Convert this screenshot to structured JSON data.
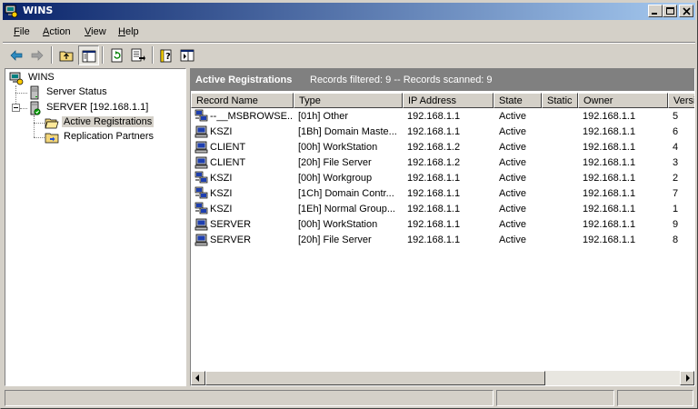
{
  "window": {
    "title": "WINS"
  },
  "menu": {
    "file": "File",
    "action": "Action",
    "view": "View",
    "help": "Help"
  },
  "tree": {
    "root": "WINS",
    "server_status": "Server Status",
    "server": "SERVER [192.168.1.1]",
    "active_registrations": "Active Registrations",
    "replication_partners": "Replication Partners"
  },
  "results": {
    "title": "Active Registrations",
    "info": "Records filtered: 9 -- Records scanned: 9",
    "columns": [
      "Record Name",
      "Type",
      "IP Address",
      "State",
      "Static",
      "Owner",
      "Versi"
    ],
    "rows": [
      {
        "icon": "group-icon",
        "name": "--__MSBROWSE...",
        "type": "[01h] Other",
        "ip": "192.168.1.1",
        "state": "Active",
        "static": "",
        "owner": "192.168.1.1",
        "version": "5"
      },
      {
        "icon": "computer-icon",
        "name": "KSZI",
        "type": "[1Bh] Domain Maste...",
        "ip": "192.168.1.1",
        "state": "Active",
        "static": "",
        "owner": "192.168.1.1",
        "version": "6"
      },
      {
        "icon": "computer-icon",
        "name": "CLIENT",
        "type": "[00h] WorkStation",
        "ip": "192.168.1.2",
        "state": "Active",
        "static": "",
        "owner": "192.168.1.1",
        "version": "4"
      },
      {
        "icon": "computer-icon",
        "name": "CLIENT",
        "type": "[20h] File Server",
        "ip": "192.168.1.2",
        "state": "Active",
        "static": "",
        "owner": "192.168.1.1",
        "version": "3"
      },
      {
        "icon": "group-icon",
        "name": "KSZI",
        "type": "[00h] Workgroup",
        "ip": "192.168.1.1",
        "state": "Active",
        "static": "",
        "owner": "192.168.1.1",
        "version": "2"
      },
      {
        "icon": "group-icon",
        "name": "KSZI",
        "type": "[1Ch] Domain Contr...",
        "ip": "192.168.1.1",
        "state": "Active",
        "static": "",
        "owner": "192.168.1.1",
        "version": "7"
      },
      {
        "icon": "group-icon",
        "name": "KSZI",
        "type": "[1Eh] Normal Group...",
        "ip": "192.168.1.1",
        "state": "Active",
        "static": "",
        "owner": "192.168.1.1",
        "version": "1"
      },
      {
        "icon": "computer-icon",
        "name": "SERVER",
        "type": "[00h] WorkStation",
        "ip": "192.168.1.1",
        "state": "Active",
        "static": "",
        "owner": "192.168.1.1",
        "version": "9"
      },
      {
        "icon": "computer-icon",
        "name": "SERVER",
        "type": "[20h] File Server",
        "ip": "192.168.1.1",
        "state": "Active",
        "static": "",
        "owner": "192.168.1.1",
        "version": "8"
      }
    ]
  },
  "colors": {
    "title_start": "#0a246a",
    "title_end": "#a6caf0",
    "face": "#d4d0c8",
    "results_header": "#808080"
  }
}
